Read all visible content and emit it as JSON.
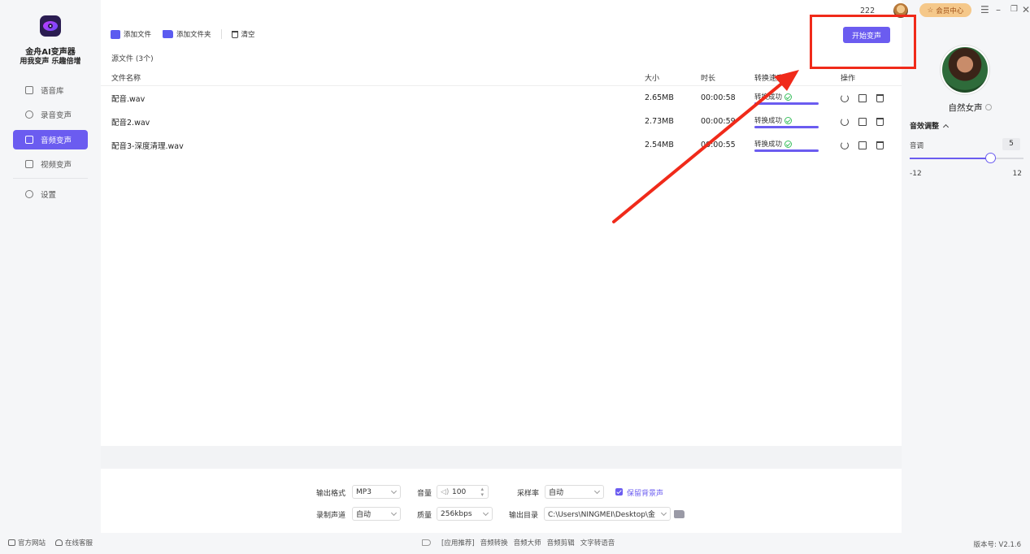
{
  "app": {
    "name": "金舟AI变声器",
    "slogan": "用我变声 乐趣倍增"
  },
  "sidebar": {
    "items": [
      {
        "label": "语音库",
        "icon": "voice-library-icon",
        "active": false
      },
      {
        "label": "录音变声",
        "icon": "microphone-icon",
        "active": false
      },
      {
        "label": "音频变声",
        "icon": "audio-change-icon",
        "active": true
      },
      {
        "label": "视频变声",
        "icon": "video-play-icon",
        "active": false
      },
      {
        "label": "设置",
        "icon": "settings-icon",
        "active": false
      }
    ],
    "footer": {
      "website": "官方网站",
      "support": "在线客服"
    }
  },
  "topbar": {
    "user_count": "222",
    "vip_label": "会员中心"
  },
  "toolbar": {
    "add_file": "添加文件",
    "add_folder": "添加文件夹",
    "clear": "清空",
    "start": "开始变声"
  },
  "source": {
    "count_label": "源文件 (3个)"
  },
  "table": {
    "headers": {
      "name": "文件名称",
      "size": "大小",
      "duration": "时长",
      "speed": "转换速度",
      "actions": "操作"
    },
    "rows": [
      {
        "name": "配音.wav",
        "size": "2.65MB",
        "duration": "00:00:58",
        "status": "转换成功",
        "progress": 1.0
      },
      {
        "name": "配音2.wav",
        "size": "2.73MB",
        "duration": "00:00:59",
        "status": "转换成功",
        "progress": 1.0
      },
      {
        "name": "配音3-深度清理.wav",
        "size": "2.54MB",
        "duration": "00:00:55",
        "status": "转换成功",
        "progress": 1.0
      }
    ]
  },
  "settings": {
    "output_format_label": "输出格式",
    "output_format": "MP3",
    "volume_label": "音量",
    "volume": "100",
    "sample_rate_label": "采样率",
    "sample_rate": "自动",
    "keep_bg_label": "保留背景声",
    "keep_bg": true,
    "channel_label": "录制声道",
    "channel": "自动",
    "quality_label": "质量",
    "quality": "256kbps",
    "output_dir_label": "输出目录",
    "output_dir": "C:\\Users\\NINGMEI\\Desktop\\金"
  },
  "footer": {
    "links": [
      "[应用推荐]",
      "音频转换",
      "音频大师",
      "音频剪辑",
      "文字转语音"
    ],
    "version": "版本号: V2.1.6"
  },
  "right_panel": {
    "voice_name": "自然女声",
    "fx_title": "音效调整",
    "pitch_label": "音调",
    "pitch_value": "5",
    "pitch_min": "-12",
    "pitch_max": "12",
    "pitch_level": 5
  },
  "colors": {
    "accent": "#6b5cf0",
    "annotation": "#f02a1a",
    "success": "#3cbf5f",
    "vip": "#f5c88a"
  }
}
